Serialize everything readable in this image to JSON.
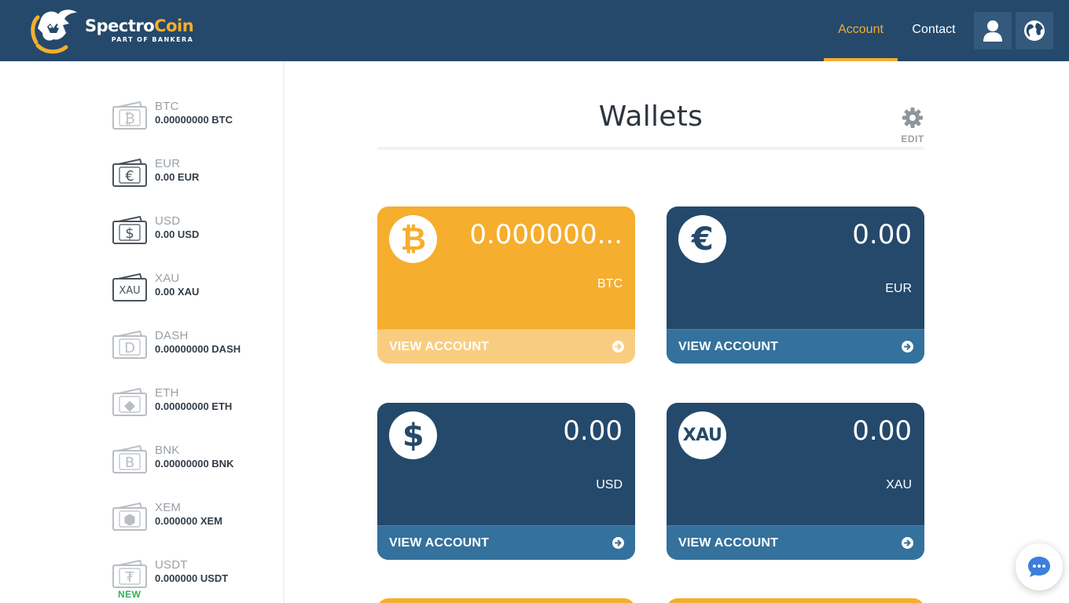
{
  "brand": {
    "name_part1": "Spectro",
    "name_part2": "Coin",
    "tagline": "PART OF BANKERA"
  },
  "nav": {
    "account": "Account",
    "contact": "Contact",
    "user_icon": "user-icon",
    "globe_icon": "globe-icon"
  },
  "sidebar": {
    "items": [
      {
        "name": "BTC",
        "balance": "0.00000000 BTC",
        "icon": "bitcoin-wallet-icon",
        "glyph": "₿"
      },
      {
        "name": "EUR",
        "balance": "0.00 EUR",
        "icon": "euro-wallet-icon",
        "glyph": "€"
      },
      {
        "name": "USD",
        "balance": "0.00 USD",
        "icon": "dollar-wallet-icon",
        "glyph": "$"
      },
      {
        "name": "XAU",
        "balance": "0.00 XAU",
        "icon": "gold-wallet-icon",
        "glyph": "XAU"
      },
      {
        "name": "DASH",
        "balance": "0.00000000 DASH",
        "icon": "dash-wallet-icon",
        "glyph": "D"
      },
      {
        "name": "ETH",
        "balance": "0.00000000 ETH",
        "icon": "ethereum-wallet-icon",
        "glyph": "◆"
      },
      {
        "name": "BNK",
        "balance": "0.00000000 BNK",
        "icon": "bankera-wallet-icon",
        "glyph": "B"
      },
      {
        "name": "XEM",
        "balance": "0.000000 XEM",
        "icon": "nem-wallet-icon",
        "glyph": "⬢"
      },
      {
        "name": "USDT",
        "balance": "0.000000 USDT",
        "icon": "tether-wallet-icon",
        "glyph": "₮"
      }
    ],
    "new_badge": "NEW"
  },
  "main": {
    "title": "Wallets",
    "edit_label": "EDIT",
    "cards": [
      {
        "amount": "0.000000...",
        "currency": "BTC",
        "cta": "VIEW ACCOUNT",
        "theme": "orange",
        "symbol": "₿",
        "icon": "bitcoin-icon"
      },
      {
        "amount": "0.00",
        "currency": "EUR",
        "cta": "VIEW ACCOUNT",
        "theme": "blue",
        "symbol": "€",
        "icon": "euro-icon"
      },
      {
        "amount": "0.00",
        "currency": "USD",
        "cta": "VIEW ACCOUNT",
        "theme": "blue",
        "symbol": "$",
        "icon": "dollar-icon"
      },
      {
        "amount": "0.00",
        "currency": "XAU",
        "cta": "VIEW ACCOUNT",
        "theme": "blue",
        "symbol": "XAU",
        "icon": "gold-icon"
      }
    ]
  },
  "colors": {
    "header": "#24496b",
    "accent": "#f5ae2e",
    "card_blue": "#24496b",
    "card_blue_footer": "#34719c",
    "card_orange_footer": "#f9cd80",
    "new_badge": "#3aad5b"
  }
}
